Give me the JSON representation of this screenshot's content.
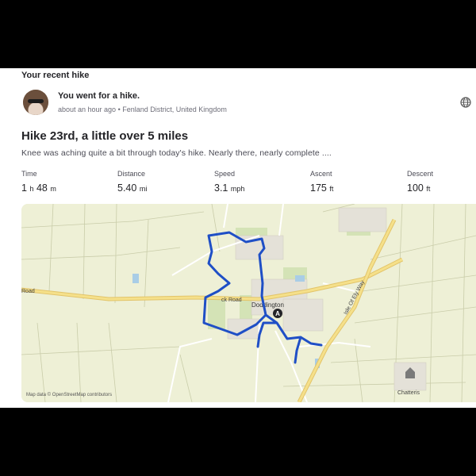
{
  "section_title": "Your recent hike",
  "activity": {
    "title": "You went for a hike.",
    "time_ago": "about an hour ago",
    "separator": "•",
    "location": "Fenland District, United Kingdom"
  },
  "hike": {
    "title": "Hike 23rd, a little over 5 miles",
    "description": "Knee  was aching quite a bit through today's hike. Nearly there, nearly complete ...."
  },
  "stats": [
    {
      "label": "Time",
      "value_a": "1",
      "unit_a": "h",
      "value_b": "48",
      "unit_b": "m"
    },
    {
      "label": "Distance",
      "value": "5.40",
      "unit": "mi"
    },
    {
      "label": "Speed",
      "value": "3.1",
      "unit": "mph"
    },
    {
      "label": "Ascent",
      "value": "175",
      "unit": "ft"
    },
    {
      "label": "Descent",
      "value": "100",
      "unit": "ft"
    }
  ],
  "map": {
    "labels": {
      "road_left": "Road",
      "road_mid": "ck Road",
      "town": "Doddington",
      "highway": "Isle Of Ely Way",
      "village": "Chatteris",
      "marker": "A"
    },
    "attribution": "Map data © OpenStreetMap contributors",
    "colors": {
      "route": "#1f4fc6",
      "land": "#eef0d6",
      "main_road": "#f5e08a",
      "minor_road": "#ffffff",
      "water": "#a9cde6"
    }
  }
}
